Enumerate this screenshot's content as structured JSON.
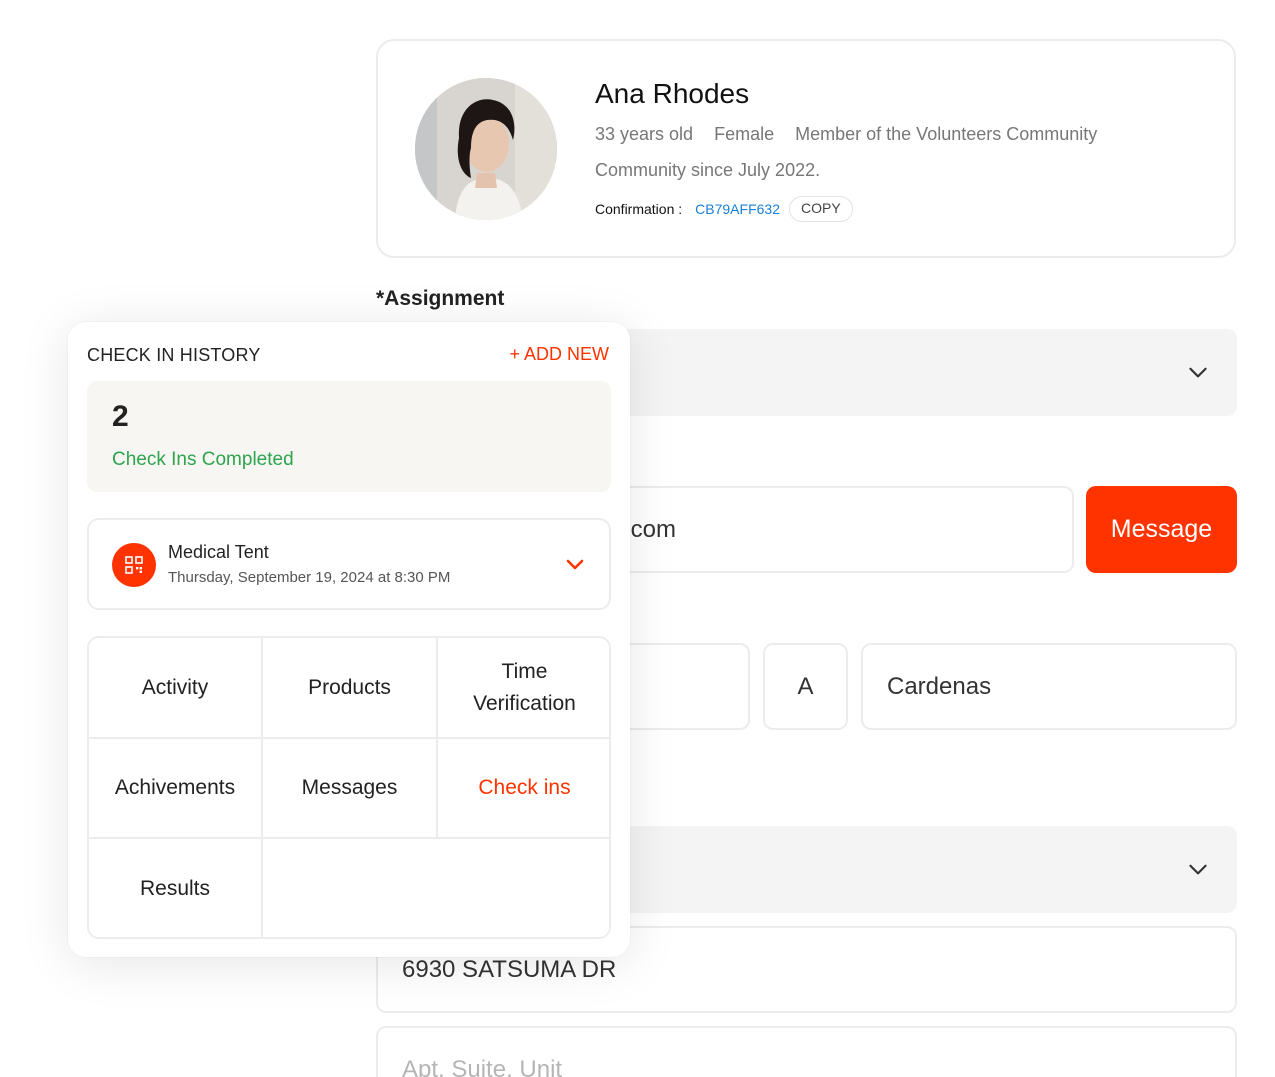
{
  "profile": {
    "name": "Ana Rhodes",
    "age": "33 years old",
    "gender": "Female",
    "membership": "Member of the Volunteers Community",
    "since": "Community since July 2022.",
    "confirmation_label": "Confirmation :",
    "confirmation_code": "CB79AFF632",
    "copy_label": "COPY"
  },
  "form": {
    "assignment_label": "*Assignment",
    "email_partial": ".com",
    "message_button": "Message",
    "middle_initial": "A",
    "last_name": "Cardenas",
    "address": "6930 SATSUMA DR",
    "apt_placeholder": "Apt, Suite, Unit"
  },
  "check_in_history": {
    "title": "CHECK IN HISTORY",
    "add_new": "+ ADD NEW",
    "count": "2",
    "count_label": "Check Ins Completed",
    "entry": {
      "location": "Medical Tent",
      "datetime": "Thursday, September 19, 2024 at 8:30 PM",
      "icon": "qr-code-icon"
    },
    "tabs": [
      {
        "label": "Activity",
        "active": false
      },
      {
        "label": "Products",
        "active": false
      },
      {
        "label": "Time Verification",
        "active": false
      },
      {
        "label": "Achivements",
        "active": false
      },
      {
        "label": "Messages",
        "active": false
      },
      {
        "label": "Check ins",
        "active": true
      },
      {
        "label": "Results",
        "active": false
      }
    ]
  },
  "colors": {
    "accent": "#ff3300",
    "link": "#1a7fd6",
    "success": "#2ea44f"
  }
}
